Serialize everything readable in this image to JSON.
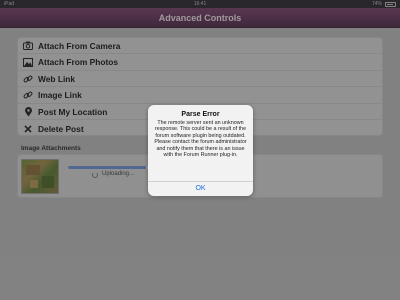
{
  "statusbar": {
    "carrier": "iPad",
    "time": "16:41",
    "battery": "74%"
  },
  "navbar": {
    "title": "Advanced Controls"
  },
  "menu": {
    "items": [
      {
        "label": "Attach From Camera",
        "icon": "camera-icon"
      },
      {
        "label": "Attach From Photos",
        "icon": "photos-icon"
      },
      {
        "label": "Web Link",
        "icon": "link-icon"
      },
      {
        "label": "Image Link",
        "icon": "image-link-icon"
      },
      {
        "label": "Post My Location",
        "icon": "location-pin-icon"
      },
      {
        "label": "Delete Post",
        "icon": "close-icon"
      }
    ]
  },
  "attachments": {
    "title": "Image Attachments",
    "status": "Uploading...",
    "progress_fraction": 0.92
  },
  "alert": {
    "title": "Parse Error",
    "message": "The remote server sent an unknown response.  This could be a result of the forum software plugin being outdated.  Please contact the forum administrator and notify them that there is an issue with the Forum Runner plug-in.",
    "ok_label": "OK"
  },
  "colors": {
    "navbar": "#5e3357",
    "alert_button": "#1d6fe0",
    "progress": "#6b8fd1"
  }
}
